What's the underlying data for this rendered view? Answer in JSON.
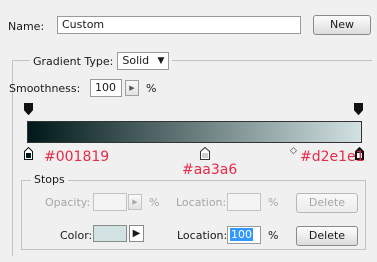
{
  "name": {
    "label": "Name:",
    "value": "Custom"
  },
  "buttons": {
    "new_label": "New",
    "delete_label": "Delete"
  },
  "gradient_type": {
    "label": "Gradient Type:",
    "value": "Solid"
  },
  "smoothness": {
    "label": "Smoothness:",
    "value": "100",
    "unit": "%"
  },
  "gradient": {
    "start_color": "#001819",
    "end_color": "#d2e1e1",
    "midpoint_color": "#aa3a6",
    "labels": {
      "left": "#001819",
      "middle": "#aa3a6",
      "right": "#d2e1e1"
    }
  },
  "stops": {
    "title": "Stops",
    "opacity": {
      "label": "Opacity:",
      "value": "",
      "unit": "%"
    },
    "opacity_location": {
      "label": "Location:",
      "value": "",
      "unit": "%"
    },
    "color": {
      "label": "Color:",
      "swatch": "#d2e1e1"
    },
    "color_location": {
      "label": "Location:",
      "value": "100",
      "unit": "%"
    }
  },
  "colors": {
    "annotation": "#e8294a",
    "selection": "#3399ff"
  }
}
